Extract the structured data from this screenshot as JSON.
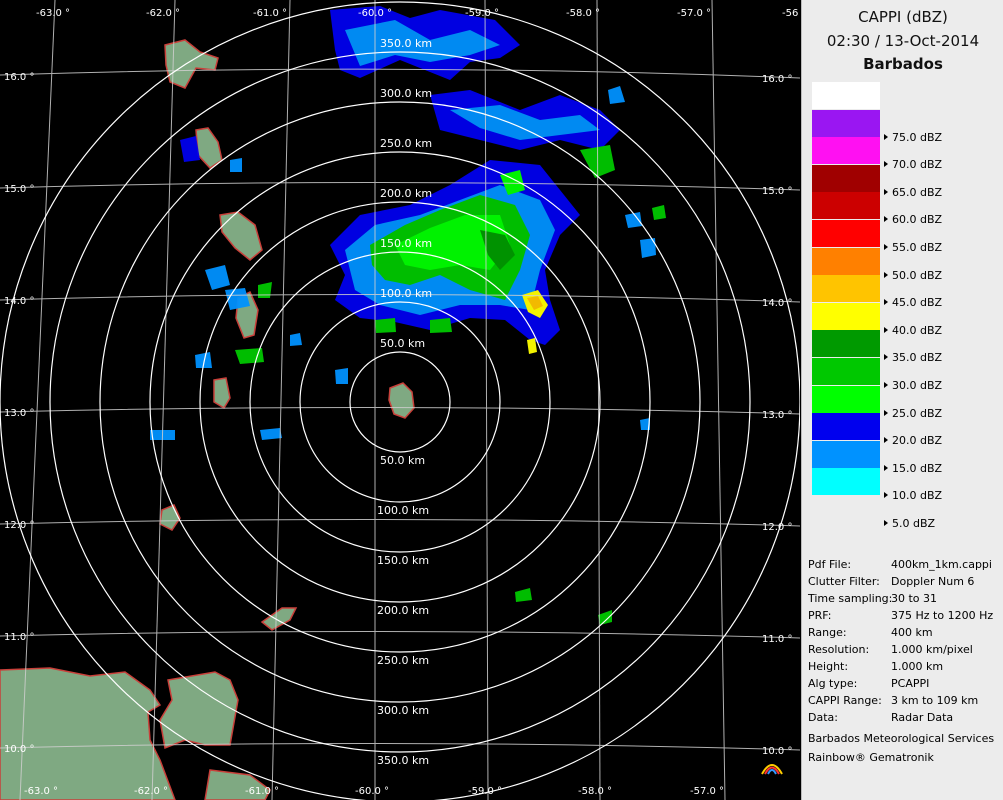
{
  "radar": {
    "range_labels_north": [
      "350.0 km",
      "300.0 km",
      "250.0 km",
      "200.0 km",
      "150.0 km",
      "100.0 km",
      "50.0 km"
    ],
    "range_labels_south": [
      "50.0 km",
      "100.0 km",
      "150.0 km",
      "200.0 km",
      "250.0 km",
      "300.0 km",
      "350.0 km"
    ],
    "lon_labels_top": [
      "-63.0 °",
      "-62.0 °",
      "-61.0 °",
      "-60.0 °",
      "-59.0 °",
      "-58.0 °",
      "-57.0 °",
      "-56"
    ],
    "lon_labels_bottom": [
      "-63.0 °",
      "-62.0 °",
      "-61.0 °",
      "-60.0 °",
      "-59.0 °",
      "-58.0 °",
      "-57.0 °"
    ],
    "lat_labels_left": [
      "16.0 °",
      "15.0 °",
      "14.0 °",
      "13.0 °",
      "12.0 °",
      "11.0 °",
      "10.0 °"
    ],
    "lat_labels_right": [
      "16.0 °",
      "15.0 °",
      "14.0 °",
      "13.0 °",
      "12.0 °",
      "11.0 °",
      "10.0 °"
    ],
    "colors": {
      "background": "#000000",
      "grid": "#ffffff",
      "land": "#7fa982",
      "coast": "#c8403a"
    }
  },
  "panel": {
    "title": "CAPPI (dBZ)",
    "datetime": "02:30 / 13-Oct-2014",
    "site": "Barbados",
    "legend": [
      {
        "label": "",
        "color": "#ffffff"
      },
      {
        "label": "75.0 dBZ",
        "color": "#9a16f2"
      },
      {
        "label": "70.0 dBZ",
        "color": "#ff10f2"
      },
      {
        "label": "65.0 dBZ",
        "color": "#a00000"
      },
      {
        "label": "60.0 dBZ",
        "color": "#cc0000"
      },
      {
        "label": "55.0 dBZ",
        "color": "#ff0000"
      },
      {
        "label": "50.0 dBZ",
        "color": "#ff8000"
      },
      {
        "label": "45.0 dBZ",
        "color": "#ffc400"
      },
      {
        "label": "40.0 dBZ",
        "color": "#ffff00"
      },
      {
        "label": "35.0 dBZ",
        "color": "#009a00"
      },
      {
        "label": "30.0 dBZ",
        "color": "#00c800"
      },
      {
        "label": "25.0 dBZ",
        "color": "#00ff00"
      },
      {
        "label": "20.0 dBZ",
        "color": "#0000ee"
      },
      {
        "label": "15.0 dBZ",
        "color": "#0092ff"
      },
      {
        "label": "10.0 dBZ",
        "color": "#00ffff"
      },
      {
        "label": "5.0 dBZ",
        "color": ""
      }
    ],
    "info": [
      {
        "key": "Pdf File:",
        "value": "400km_1km.cappi"
      },
      {
        "key": "Clutter Filter:",
        "value": "Doppler Num 6"
      },
      {
        "key": "Time sampling:",
        "value": "30 to 31"
      },
      {
        "key": "PRF:",
        "value": "375 Hz to 1200 Hz"
      },
      {
        "key": "Range:",
        "value": "400 km"
      },
      {
        "key": "Resolution:",
        "value": "1.000 km/pixel"
      },
      {
        "key": "Height:",
        "value": "1.000 km"
      },
      {
        "key": "Alg type:",
        "value": "PCAPPI"
      },
      {
        "key": "CAPPI Range:",
        "value": "3 km to 109 km"
      },
      {
        "key": "Data:",
        "value": "Radar Data"
      }
    ],
    "org": "Barbados Meteorological Services",
    "brand": "Rainbow® Gematronik"
  }
}
